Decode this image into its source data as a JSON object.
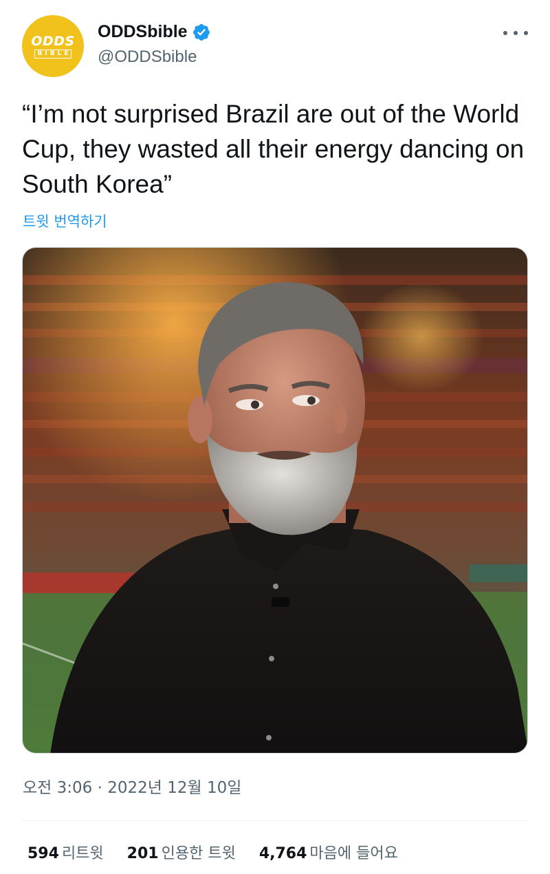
{
  "account": {
    "display_name": "ODDSbible",
    "handle": "@ODDSbible",
    "avatar_logo_top": "ODDS",
    "avatar_logo_bottom": "BIBLE",
    "avatar_color": "#f2c21c",
    "verified": true,
    "verified_icon": "verified-badge-icon"
  },
  "more_icon": "more-options-icon",
  "tweet": {
    "text": "“I’m not surprised Brazil are out of the World Cup, they wasted all their energy dancing on South Korea”",
    "translate_label": "트윗 번역하기"
  },
  "media": {
    "type": "photo"
  },
  "meta": {
    "time": "오전 3:06",
    "separator": " · ",
    "date": "2022년 12월 10일"
  },
  "stats": {
    "retweets_count": "594",
    "retweets_label": "리트윗",
    "quotes_count": "201",
    "quotes_label": "인용한 트윗",
    "likes_count": "4,764",
    "likes_label": "마음에 들어요"
  },
  "colors": {
    "link": "#1d9bf0",
    "secondary_text": "#536471",
    "primary_text": "#0f1419"
  }
}
